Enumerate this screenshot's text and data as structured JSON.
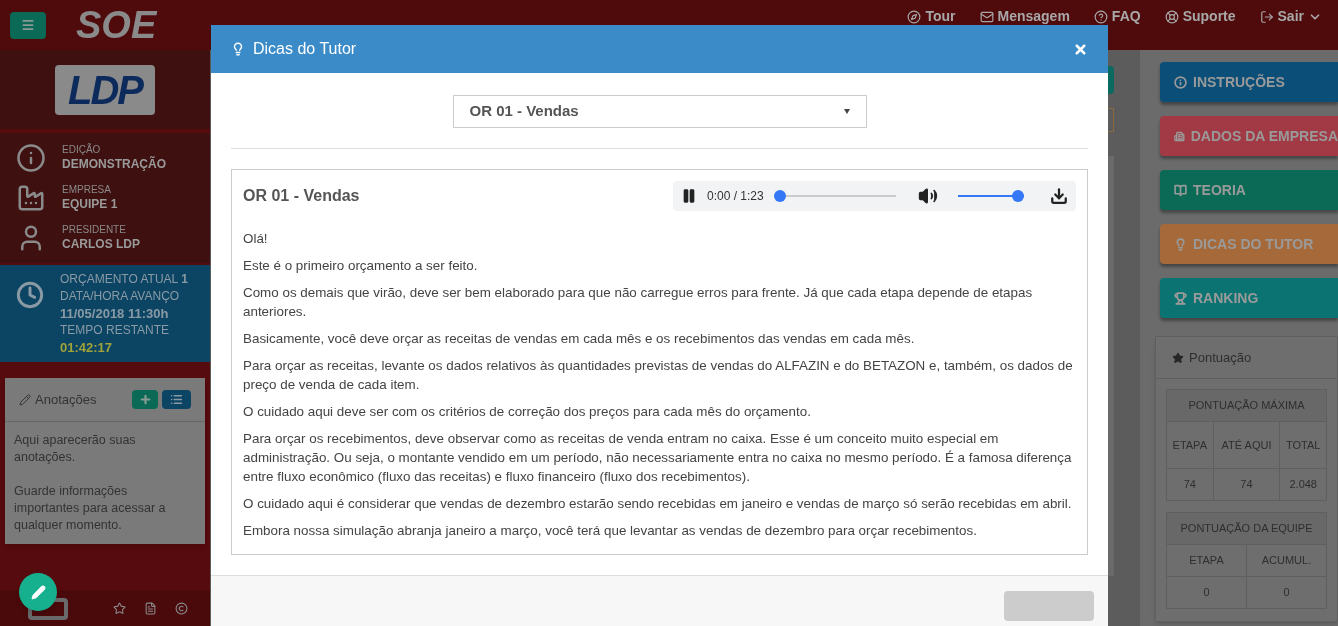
{
  "app_title": "SOE",
  "nav": [
    {
      "label": "Tour",
      "kind": "tour"
    },
    {
      "label": "Mensagem",
      "kind": "mail"
    },
    {
      "label": "FAQ",
      "kind": "faq"
    },
    {
      "label": "Suporte",
      "kind": "support"
    },
    {
      "label": "Sair",
      "kind": "logout"
    }
  ],
  "sidebar": {
    "logo": "LDP",
    "info": [
      {
        "label": "EDIÇÃO",
        "value": "DEMONSTRAÇÃO",
        "kind": "info"
      },
      {
        "label": "EMPRESA",
        "value": "EQUIPE 1",
        "kind": "company"
      },
      {
        "label": "PRESIDENTE",
        "value": "CARLOS LDP",
        "kind": "person"
      }
    ],
    "budget": {
      "current": "ORÇAMENTO ATUAL **1**",
      "date_label": "DATA/HORA AVANÇO",
      "date": "11/05/2018 11:30h",
      "remaining_label": "TEMPO RESTANTE",
      "remaining": "01:42:17"
    },
    "notes": {
      "title": "Anotações",
      "paragraphs": [
        "Aqui aparecerão suas anotações.",
        "Guarde informações importantes para acessar a qualquer momento."
      ]
    }
  },
  "right_panel": {
    "buttons": [
      {
        "label": "INSTRUÇÕES",
        "kind": "info",
        "color": "#0b4f78"
      },
      {
        "label": "DADOS DA EMPRESA",
        "kind": "building",
        "color": "#a23a45"
      },
      {
        "label": "TEORIA",
        "kind": "book",
        "color": "#0a6a55"
      },
      {
        "label": "DICAS DO TUTOR",
        "kind": "bulb",
        "color": "#a5693a"
      },
      {
        "label": "RANKING",
        "kind": "trophy",
        "color": "#0b7472"
      }
    ],
    "score": {
      "title": "Pontuação",
      "max": {
        "heading": "PONTUAÇÃO MÁXIMA",
        "columns": [
          "ETAPA",
          "ATÉ AQUI",
          "TOTAL"
        ],
        "values": [
          "74",
          "74",
          "2.048"
        ]
      },
      "team": {
        "heading": "PONTUAÇÃO DA EQUIPE",
        "columns": [
          "ETAPA",
          "ACUMUL."
        ],
        "values": [
          "0",
          "0"
        ]
      }
    }
  },
  "modal": {
    "title": "Dicas do Tutor",
    "select": {
      "value": "OR 01 - Vendas"
    },
    "content_title": "OR 01 - Vendas",
    "audio": {
      "playing": true,
      "time": "0:00 / 1:23",
      "level": 0.0,
      "volume": {
        "level": 1.0
      }
    },
    "paragraphs": [
      "Olá!",
      "Este é o primeiro orçamento a ser feito.",
      "Como os demais que virão, deve ser bem elaborado para que não carregue erros para frente. Já que cada etapa depende de etapas anteriores.",
      "Basicamente, você deve orçar as receitas de vendas em cada mês e os recebimentos das vendas em cada mês.",
      "Para orçar as receitas, levante os dados relativos às quantidades previstas de vendas do ALFAZIN e do BETAZON e, também, os dados de preço de venda de cada item.",
      "O cuidado aqui deve ser com os critérios de correção dos preços para cada mês do orçamento.",
      "Para orçar os recebimentos, deve observar como as receitas de venda entram no caixa. Esse é um conceito muito especial em administração. Ou seja, o montante vendido em um período, não necessariamente entra no caixa no mesmo período. É a famosa diferença entre fluxo econômico (fluxo das receitas) e fluxo financeiro (fluxo dos recebimentos).",
      "O cuidado aqui é considerar que vendas de dezembro estarão sendo recebidas em janeiro e vendas de março só serão recebidas em abril.",
      "Embora nossa simulação abranja janeiro a março, você terá que levantar as vendas de dezembro para orçar recebimentos."
    ]
  }
}
